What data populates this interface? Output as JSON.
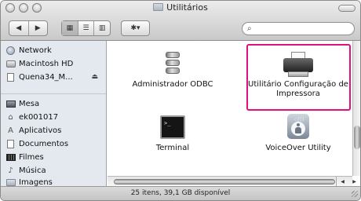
{
  "window": {
    "title": "Utilitários"
  },
  "toolbar": {
    "back_label": "◀",
    "forward_label": "▶",
    "view_icon_label": "▦",
    "view_list_label": "☰",
    "view_column_label": "▥",
    "action_label": "✱▾",
    "search_value": ""
  },
  "sidebar": {
    "devices": [
      {
        "label": "Network",
        "icon": "globe-icon"
      },
      {
        "label": "Macintosh HD",
        "icon": "hard-disk-icon"
      },
      {
        "label": "Quena34_M...",
        "icon": "document-icon",
        "eject": "⏏"
      }
    ],
    "places": [
      {
        "label": "Mesa",
        "icon": "desktop-icon"
      },
      {
        "label": "ek001017",
        "icon": "home-icon",
        "glyph": "⌂"
      },
      {
        "label": "Aplicativos",
        "icon": "applications-icon",
        "glyph": "A"
      },
      {
        "label": "Documentos",
        "icon": "folder-icon"
      },
      {
        "label": "Filmes",
        "icon": "film-icon"
      },
      {
        "label": "Música",
        "icon": "music-icon",
        "glyph": "♪"
      },
      {
        "label": "Imagens",
        "icon": "pictures-icon"
      }
    ]
  },
  "files": [
    {
      "name": "Administrador ODBC",
      "icon": "odbc-icon"
    },
    {
      "name_line1": "Utilitário Configuração de",
      "name_line2": "Impressora",
      "icon": "printer-icon",
      "highlighted": true
    },
    {
      "name": "Terminal",
      "icon": "terminal-icon"
    },
    {
      "name": "VoiceOver Utility",
      "icon": "voiceover-icon"
    }
  ],
  "status": {
    "text": "25 itens, 39,1 GB disponível"
  },
  "colors": {
    "highlight": "#e0117f",
    "sidebar_bg": "#e4e9ef"
  }
}
